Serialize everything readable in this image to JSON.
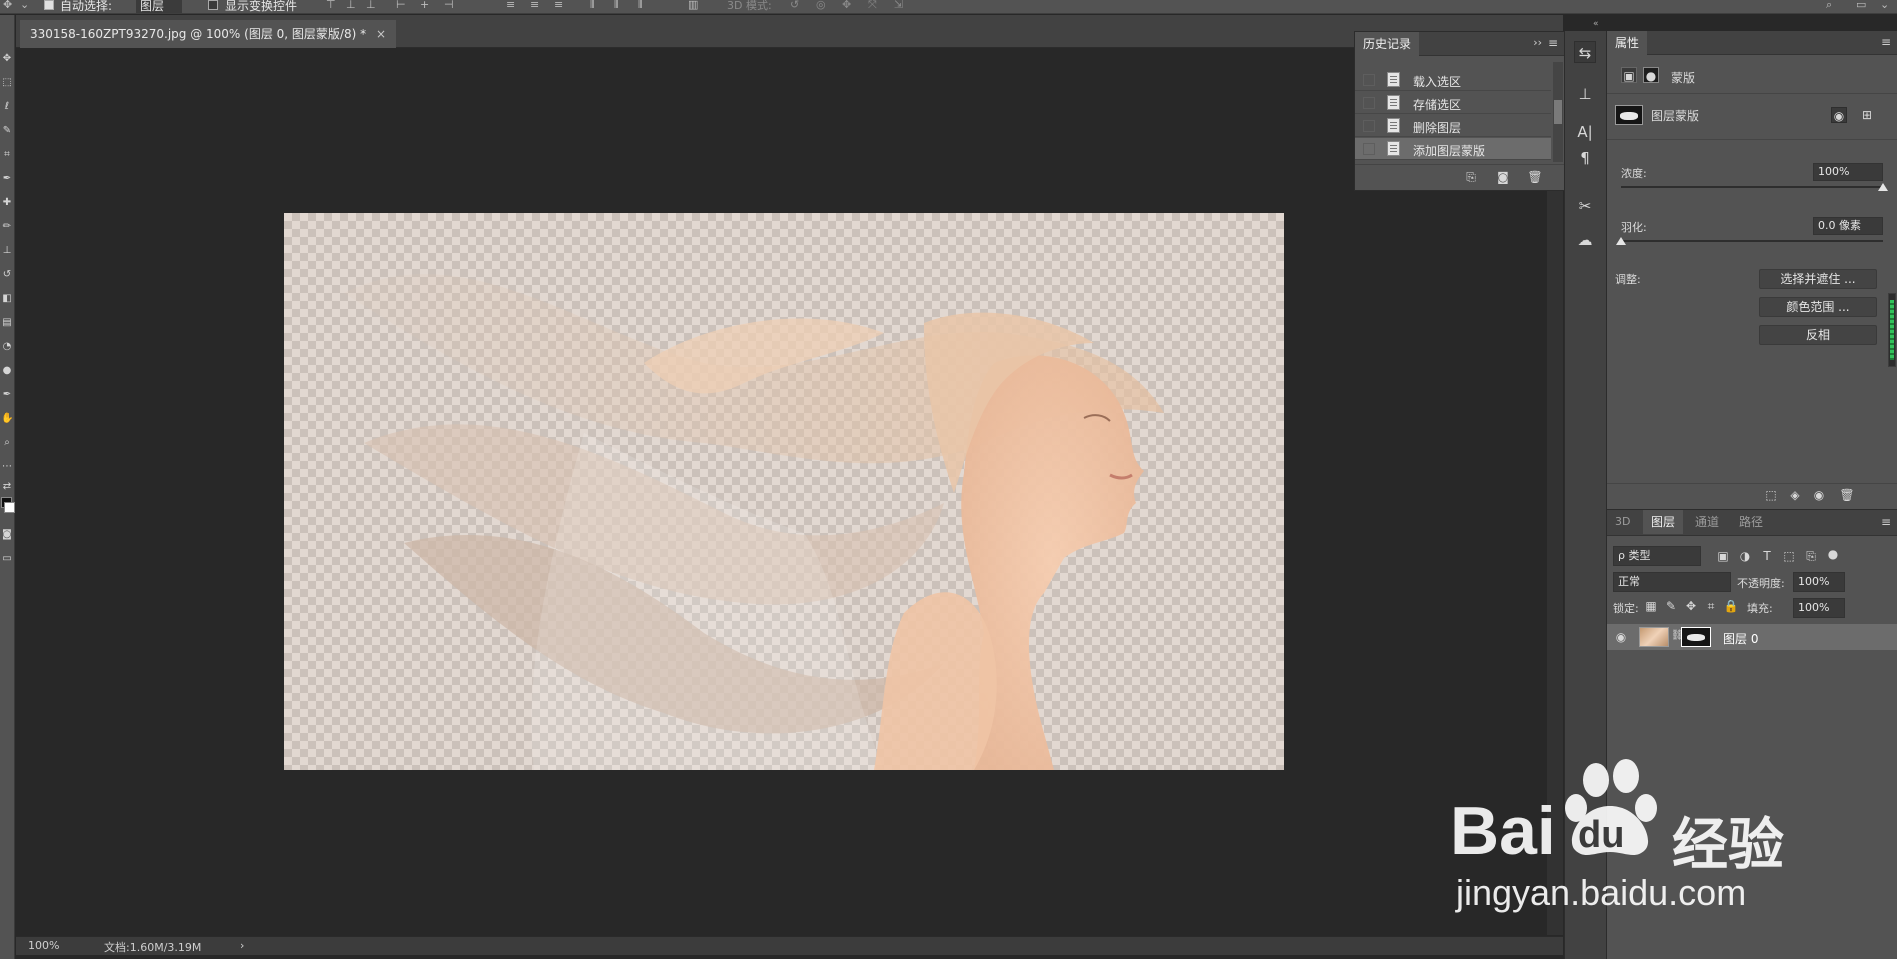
{
  "options_bar": {
    "auto_select_label": "自动选择:",
    "auto_select_target": "图层",
    "show_transform_label": "显示变换控件",
    "mode_3d_label": "3D 模式:"
  },
  "document": {
    "tab_title": "330158-160ZPT93270.jpg @ 100% (图层 0, 图层蒙版/8) *",
    "close_glyph": "×"
  },
  "status_bar": {
    "zoom": "100%",
    "doc_info": "文档:1.60M/3.19M",
    "arrow": "›"
  },
  "history_panel": {
    "title": "历史记录",
    "menu_glyph": "≡",
    "collapse_glyph": "››",
    "items": [
      {
        "label": "载入选区"
      },
      {
        "label": "存储选区"
      },
      {
        "label": "删除图层"
      },
      {
        "label": "添加图层蒙版"
      }
    ]
  },
  "properties_panel": {
    "title": "属性",
    "mask_section_label": "蒙版",
    "layer_mask_label": "图层蒙版",
    "density_label": "浓度:",
    "density_value": "100%",
    "density_level": 1.0,
    "feather_label": "羽化:",
    "feather_value": "0.0 像素",
    "feather_level": 0.0,
    "adjust_label": "调整:",
    "buttons": {
      "select_and_mask": "选择并遮住 ...",
      "color_range": "颜色范围 ...",
      "invert": "反相"
    }
  },
  "layers_panel": {
    "tabs": [
      "3D",
      "图层",
      "通道",
      "路径"
    ],
    "active_tab": "图层",
    "filter_kind": "ρ 类型",
    "blend_mode": "正常",
    "opacity_label": "不透明度:",
    "opacity_value": "100%",
    "lock_label": "锁定:",
    "fill_label": "填充:",
    "fill_value": "100%",
    "layers": [
      {
        "name": "图层 0",
        "visible": true
      }
    ]
  },
  "watermark": {
    "brand_left": "Bai",
    "brand_mid": "du",
    "brand_cn": "经验",
    "url": "jingyan.baidu.com"
  },
  "colors": {
    "accent_selected": "#6c6c6c",
    "panel_bg": "#535353",
    "canvas_bg": "#282828"
  }
}
